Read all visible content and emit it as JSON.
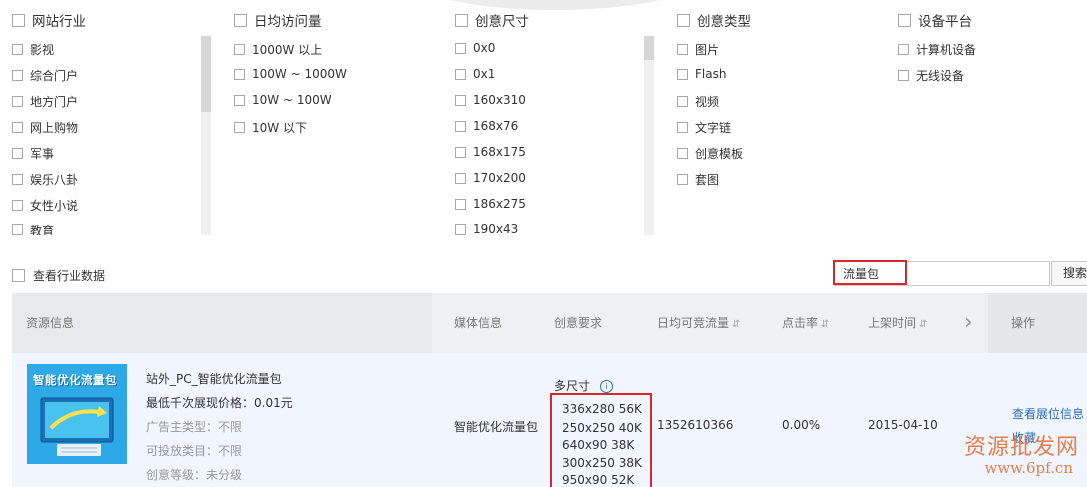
{
  "filters": [
    {
      "header": "网站行业",
      "options": [
        "影视",
        "综合门户",
        "地方门户",
        "网上购物",
        "军事",
        "娱乐八卦",
        "女性小说",
        "教育"
      ]
    },
    {
      "header": "日均访问量",
      "options": [
        "1000W 以上",
        "100W ~ 1000W",
        "10W ~ 100W",
        "10W 以下"
      ]
    },
    {
      "header": "创意尺寸",
      "options": [
        "0x0",
        "0x1",
        "160x310",
        "168x76",
        "168x175",
        "170x200",
        "186x275",
        "190x43"
      ]
    },
    {
      "header": "创意类型",
      "options": [
        "图片",
        "Flash",
        "视频",
        "文字链",
        "创意模板",
        "套图"
      ]
    },
    {
      "header": "设备平台",
      "options": [
        "计算机设备",
        "无线设备"
      ]
    }
  ],
  "check_industry_label": "查看行业数据",
  "search": {
    "value": "流量包",
    "button": "搜索"
  },
  "table": {
    "headers": {
      "resource": "资源信息",
      "media": "媒体信息",
      "creative": "创意要求",
      "traffic": "日均可竞流量",
      "ctr": "点击率",
      "online": "上架时间",
      "next": "›",
      "op": "操作",
      "sort_icon": "⇵"
    },
    "row": {
      "thumb_text": "智能优化流量包",
      "name": "站外_PC_智能优化流量包",
      "price": "最低千次展现价格：0.01元",
      "advertiser": "广告主类型：不限",
      "category": "可投放类目：不限",
      "level": "创意等级：未分级",
      "media": "智能优化流量包",
      "multi_size": "多尺寸",
      "sizes": [
        "336x280  56K",
        "250x250  40K",
        "640x90  38K",
        "300x250  38K",
        "950x90  52K"
      ],
      "traffic": "1352610366",
      "ctr": "0.00%",
      "online": "2015-04-10",
      "op_view": "查看展位信息",
      "op_fav": "收藏"
    }
  },
  "watermark": {
    "line1": "资源批发网",
    "line2": "www.6pf.cn"
  },
  "colors": {
    "highlight": "#d9272e",
    "link": "#2f6fb5",
    "thumb_bg": "#2da9e8",
    "row_bg": "#f0f5ff"
  }
}
